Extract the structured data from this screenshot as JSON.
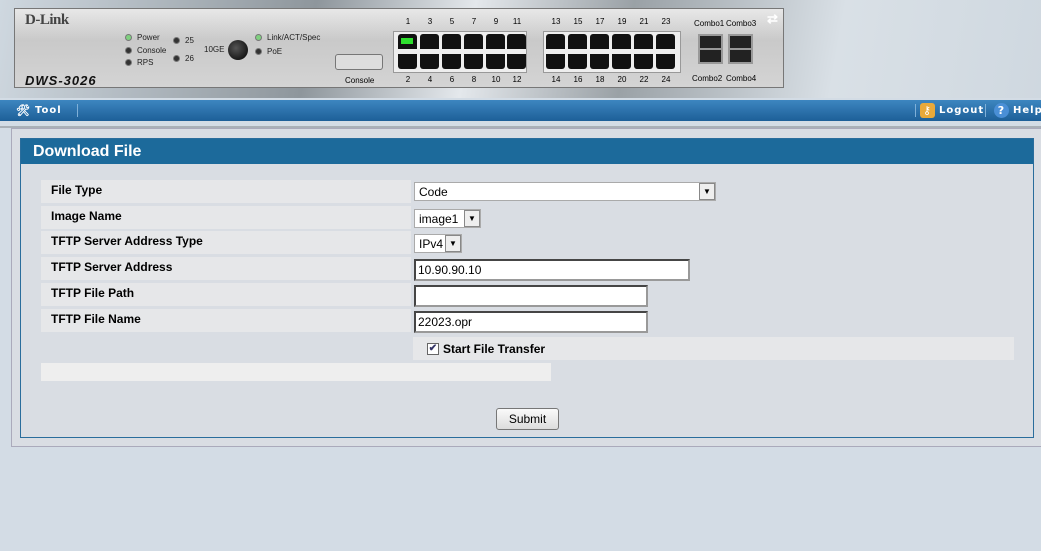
{
  "device": {
    "brand": "D-Link",
    "model": "DWS-3026",
    "leds": [
      "Power",
      "Console",
      "RPS",
      "25",
      "26",
      "10GE",
      "Link/ACT/Spec",
      "PoE"
    ],
    "console_label": "Console",
    "ports_top": [
      "1",
      "3",
      "5",
      "7",
      "9",
      "11",
      "13",
      "15",
      "17",
      "19",
      "21",
      "23"
    ],
    "ports_bottom": [
      "2",
      "4",
      "6",
      "8",
      "10",
      "12",
      "14",
      "16",
      "18",
      "20",
      "22",
      "24"
    ],
    "active_ports": [
      "1"
    ],
    "combos": [
      "Combo1",
      "Combo3",
      "Combo2",
      "Combo4"
    ]
  },
  "toolbar": {
    "tool": "Tool",
    "logout": "Logout",
    "help": "Help"
  },
  "panel": {
    "title": "Download File",
    "fields": [
      {
        "label": "File Type",
        "value": "Code"
      },
      {
        "label": "Image Name",
        "value": "image1"
      },
      {
        "label": "TFTP Server Address Type",
        "value": "IPv4"
      },
      {
        "label": "TFTP Server Address",
        "value": "10.90.90.10"
      },
      {
        "label": "TFTP File Path",
        "value": ""
      },
      {
        "label": "TFTP File Name",
        "value": "22023.opr"
      }
    ],
    "start_transfer": {
      "label": "Start File Transfer",
      "checked": true
    },
    "submit": "Submit"
  }
}
